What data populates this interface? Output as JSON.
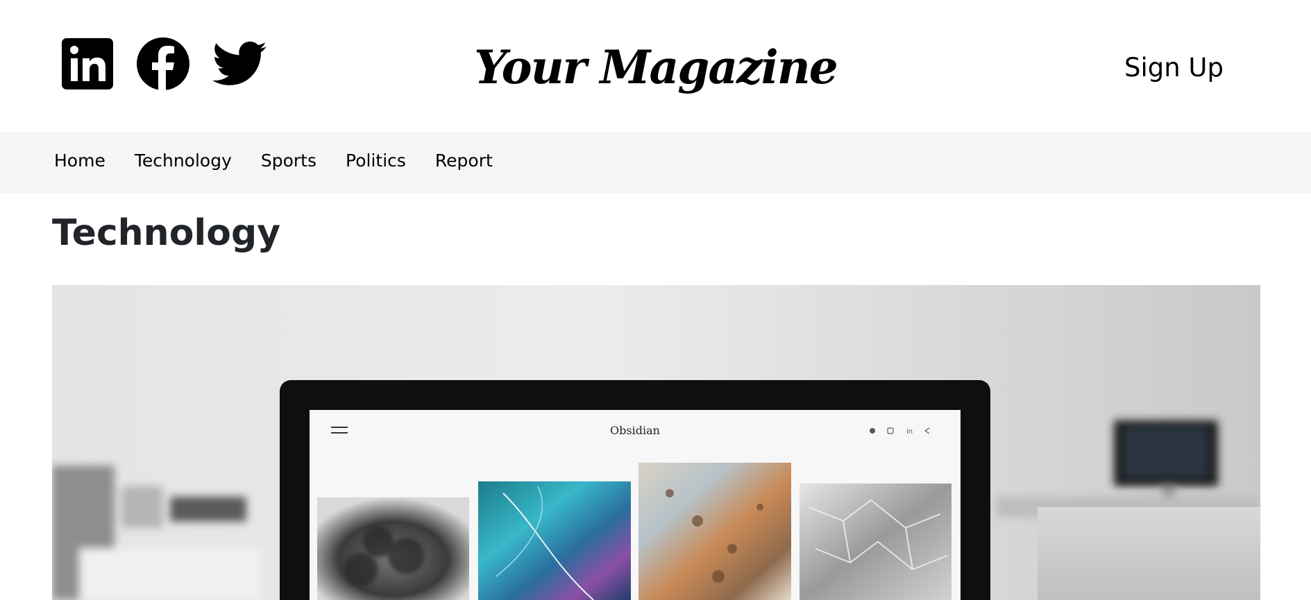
{
  "header": {
    "brand": "Your Magazine",
    "signup_label": "Sign Up",
    "socials": [
      {
        "icon": "linkedin-icon"
      },
      {
        "icon": "facebook-icon"
      },
      {
        "icon": "twitter-icon"
      }
    ]
  },
  "nav": {
    "items": [
      {
        "label": "Home"
      },
      {
        "label": "Technology"
      },
      {
        "label": "Sports"
      },
      {
        "label": "Politics"
      },
      {
        "label": "Report"
      }
    ]
  },
  "page": {
    "title": "Technology"
  },
  "hero": {
    "screen_brand": "Obsidian",
    "screen_icons": [
      "twitter-icon",
      "instagram-icon",
      "linkedin-icon",
      "share-icon"
    ]
  },
  "colors": {
    "nav_bg": "#f5f5f5",
    "title_text": "#212529"
  }
}
